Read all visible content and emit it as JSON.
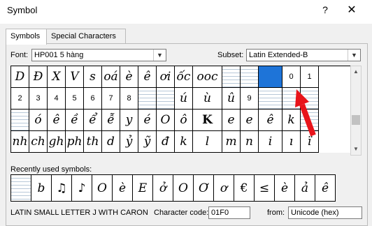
{
  "window": {
    "title": "Symbol",
    "help_label": "?",
    "close_label": "✕"
  },
  "tabs": [
    {
      "label": "Symbols"
    },
    {
      "label": "Special Characters"
    }
  ],
  "font": {
    "label": "Font:",
    "value": "HP001 5 hàng"
  },
  "subset": {
    "label": "Subset:",
    "value": "Latin Extended-B"
  },
  "grid": {
    "rows": [
      [
        "D",
        "Đ",
        "X",
        "V",
        "s",
        "oá",
        "è",
        "ê",
        "ơi",
        "ốc",
        "ooc",
        "",
        "",
        "",
        "0",
        "1"
      ],
      [
        "2",
        "3",
        "4",
        "5",
        "6",
        "7",
        "8",
        "",
        "",
        "ú",
        "ù",
        "û",
        "9",
        "",
        "",
        ""
      ],
      [
        "",
        "ó",
        "ê",
        "ề",
        "ể",
        "ễ",
        "y",
        "é",
        "O",
        "ô",
        "K",
        "e",
        "e",
        "ê",
        "k",
        ""
      ],
      [
        "nh",
        "ch",
        "gh",
        "ph",
        "th",
        "d",
        "ỷ",
        "ỹ",
        "đ",
        "k",
        "l",
        "m",
        "n",
        "i",
        "ı",
        "ï"
      ]
    ]
  },
  "recent": {
    "label": "Recently used symbols:",
    "symbols": [
      "",
      "b",
      "♫",
      "♪",
      "O",
      "è",
      "E",
      "ở",
      "O",
      "Ơ",
      "ơ",
      "€",
      "≤",
      "è",
      "ả",
      "ê"
    ]
  },
  "status": {
    "char_name": "LATIN SMALL LETTER J WITH CARON",
    "code_label": "Character code:",
    "code_value": "01F0",
    "from_label": "from:",
    "from_value": "Unicode (hex)"
  },
  "annotation": {
    "color": "#e8141b"
  },
  "icons": {
    "dropdown": "chevron-down-icon",
    "scroll_up": "arrow-up-icon",
    "scroll_down": "arrow-down-icon"
  }
}
